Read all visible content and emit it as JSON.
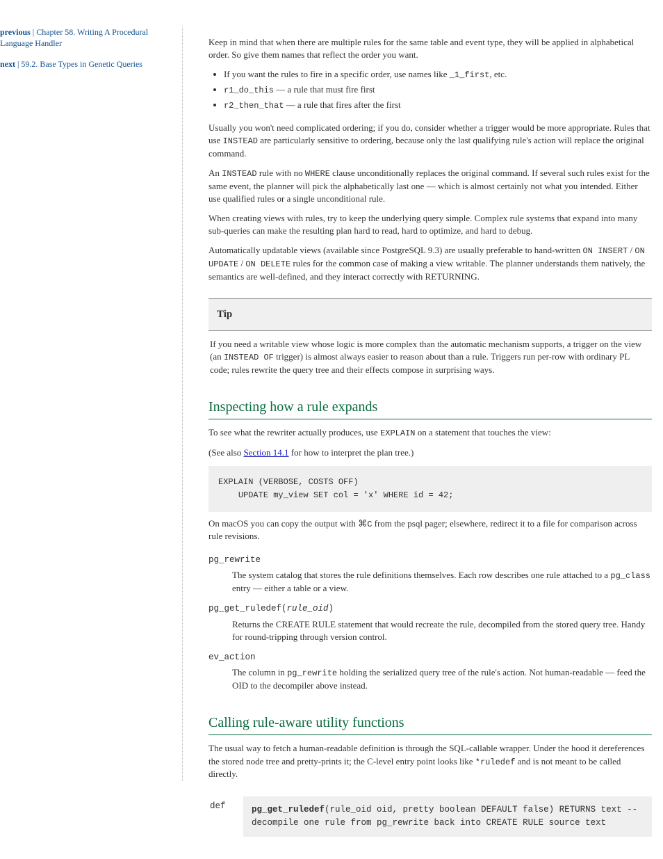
{
  "sidebar": {
    "prev_label": "previous",
    "prev_sep": " | ",
    "prev_title": "Chapter 58. Writing A Procedural Language Handler",
    "next_label": "next",
    "next_sep": " | ",
    "next_title": "59.2. Base Types in Genetic Queries"
  },
  "intro": {
    "p1": "Keep in mind that when there are multiple rules for the same table and event type, they will be applied in alphabetical order. So give them names that reflect the order you want.",
    "list": [
      {
        "before": "If you want the rules to fire in a specific order, use names like ",
        "code": "_1_first",
        "after": ", etc."
      },
      {
        "before": "",
        "code": "r1_do_this",
        "after": " — a rule that must fire first"
      },
      {
        "before": "",
        "code": "r2_then_that",
        "after": " — a rule that fires after the first"
      }
    ],
    "p2_before": "Usually you won't need complicated ordering; if you do, consider whether a trigger would be more appropriate. Rules that use ",
    "p2_code": "INSTEAD",
    "p2_after": " are particularly sensitive to ordering, because only the last qualifying rule's action will replace the original command.",
    "p3_before": "An ",
    "p3_code1": "INSTEAD",
    "p3_mid": " rule with no ",
    "p3_code2": "WHERE",
    "p3_after": " clause unconditionally replaces the original command. If several such rules exist for the same event, the planner will pick the alphabetically last one — which is almost certainly not what you intended. Either use qualified rules or a single unconditional rule.",
    "p4": "When creating views with rules, try to keep the underlying query simple. Complex rule systems that expand into many sub-queries can make the resulting plan hard to read, hard to optimize, and hard to debug.",
    "p5_before": "Automatically updatable views (available since PostgreSQL 9.3) are usually preferable to hand-written ",
    "p5_code1": "ON INSERT",
    "p5_mid1": " / ",
    "p5_code2": "ON UPDATE",
    "p5_mid2": " / ",
    "p5_code3": "ON DELETE",
    "p5_after": " rules for the common case of making a view writable. The planner understands them natively, the semantics are well-defined, and they interact correctly with RETURNING."
  },
  "tip": {
    "heading": "Tip",
    "body_before": "If you need a writable view whose logic is more complex than the automatic mechanism supports, a trigger on the view (an ",
    "body_code": "INSTEAD OF",
    "body_after": " trigger) is almost always easier to reason about than a rule. Triggers run per-row with ordinary PL code; rules rewrite the query tree and their effects compose in surprising ways."
  },
  "section_inspect": {
    "title": "Inspecting how a rule expands",
    "p1_before": "To see what the rewriter actually produces, use ",
    "p1_code": "EXPLAIN",
    "p1_after": " on a statement that touches the view:",
    "p2_before": "(See also ",
    "p2_link": "Section 14.1",
    "p2_after": " for how to interpret the plan tree.)",
    "code1_l1": "EXPLAIN (VERBOSE, COSTS OFF)",
    "code1_l2": "    UPDATE my_view SET col = 'x' WHERE id = 42;",
    "p3_prefix": "On macOS you can copy the output with ",
    "p3_shortcut_cmd": "⌘",
    "p3_shortcut_key": "C",
    "p3_after": " from the psql pager; elsewhere, redirect it to a file for comparison across rule revisions.",
    "dl": [
      {
        "term": "pg_rewrite",
        "def_before": "The system catalog that stores the rule definitions themselves. Each row describes one rule attached to a ",
        "def_code": "pg_class",
        "def_after": " entry — either a table or a view."
      },
      {
        "term_prefix": "pg_get_ruledef(",
        "term_arg": "rule_oid",
        "term_suffix": ")",
        "def": "Returns the CREATE RULE statement that would recreate the rule, decompiled from the stored query tree. Handy for round-tripping through version control."
      },
      {
        "term": "ev_action",
        "def_before": "The column in ",
        "def_code": "pg_rewrite",
        "def_after": " holding the serialized query tree of the rule's action. Not human-readable — feed the OID to the decompiler above instead."
      }
    ]
  },
  "section_calling": {
    "title": "Calling rule-aware utility functions",
    "p1_before": "The usual way to fetch a human-readable definition is through the SQL-callable wrapper. Under the hood it dereferences the stored node tree and pretty-prints it; the C-level entry point looks like ",
    "p1_deref": "*ruledef",
    "p1_after": " and is not meant to be called directly.",
    "sig_def": "def",
    "sig_name": "pg_get_ruledef",
    "sig_args": "(rule_oid oid, pretty boolean DEFAULT false) RETURNS text -- decompile one rule from pg_rewrite back into CREATE RULE source text"
  }
}
